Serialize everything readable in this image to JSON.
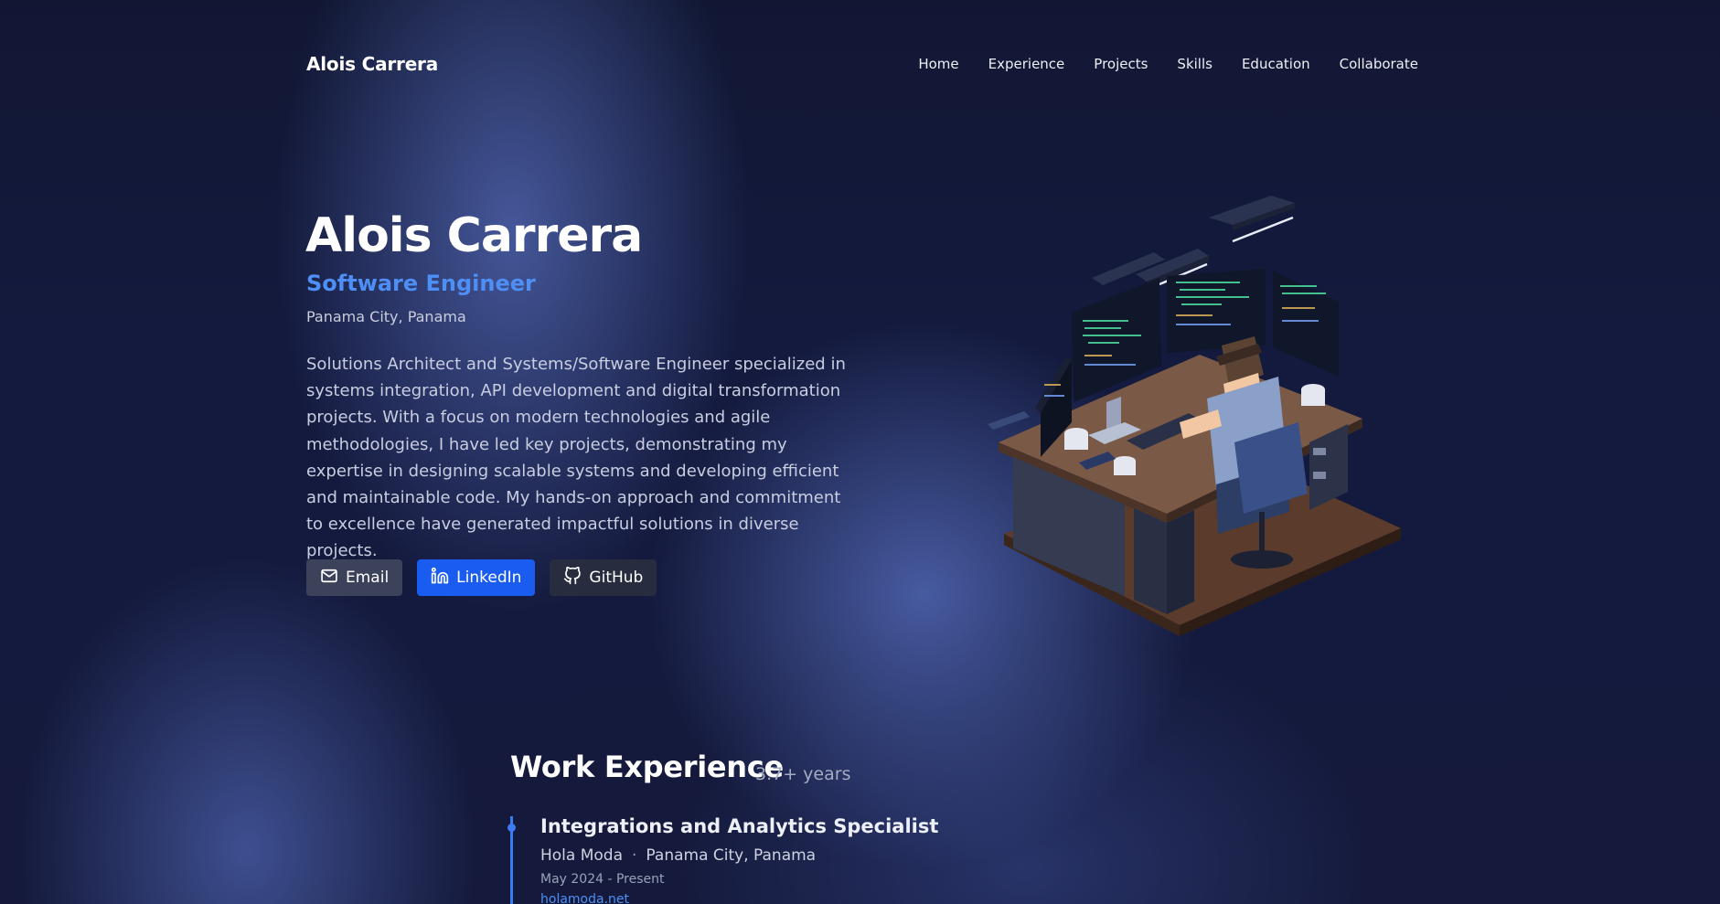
{
  "nav": {
    "brand": "Alois Carrera",
    "links": [
      "Home",
      "Experience",
      "Projects",
      "Skills",
      "Education",
      "Collaborate"
    ]
  },
  "hero": {
    "name": "Alois Carrera",
    "role": "Software Engineer",
    "location": "Panama City, Panama",
    "bio": "Solutions Architect and Systems/Software Engineer specialized in systems integration, API development and digital transformation projects. With a focus on modern technologies and agile methodologies, I have led key projects, demonstrating my expertise in designing scalable systems and developing efficient and maintainable code. My hands-on approach and commitment to excellence have generated impactful solutions in diverse projects.",
    "buttons": {
      "email": "Email",
      "linkedin": "LinkedIn",
      "github": "GitHub"
    }
  },
  "experience": {
    "title": "Work Experience",
    "years": "3.7+ years",
    "jobs": [
      {
        "title": "Integrations and Analytics Specialist",
        "company": "Hola Moda",
        "separator": "·",
        "location": "Panama City, Panama",
        "dates": "May 2024 - Present",
        "link": "holamoda.net"
      }
    ]
  },
  "colors": {
    "accent": "#4d8ff5",
    "linkedin_button": "#1a5cf0",
    "email_button": "#3b4259",
    "github_button": "#272d3f",
    "background": "#141a3e"
  }
}
